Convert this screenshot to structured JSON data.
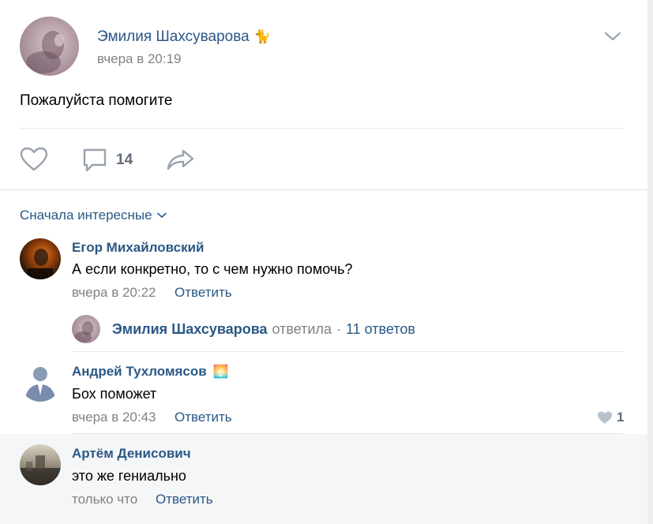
{
  "post": {
    "author": "Эмилия Шахсуварова",
    "author_emoji": "🐈",
    "time": "вчера в 20:19",
    "text": "Пожалуйста помогите",
    "comments_count": "14"
  },
  "comments_header": {
    "sort_label": "Сначала интересные"
  },
  "comments": [
    {
      "author": "Егор Михайловский",
      "text": "А если конкретно, то с чем нужно помочь?",
      "time": "вчера в 20:22",
      "reply_label": "Ответить",
      "thread": {
        "author": "Эмилия Шахсуварова",
        "verb": "ответила",
        "separator": "·",
        "replies": "11 ответов"
      }
    },
    {
      "author": "Андрей Тухломясов",
      "author_emoji": "🌅",
      "text": "Бох поможет",
      "time": "вчера в 20:43",
      "reply_label": "Ответить",
      "likes": "1"
    },
    {
      "author": "Артём Денисович",
      "text": "это же гениально",
      "time": "только что",
      "reply_label": "Ответить"
    }
  ],
  "colors": {
    "link": "#2a5885",
    "muted": "#828282",
    "icon": "#99a2ad"
  }
}
